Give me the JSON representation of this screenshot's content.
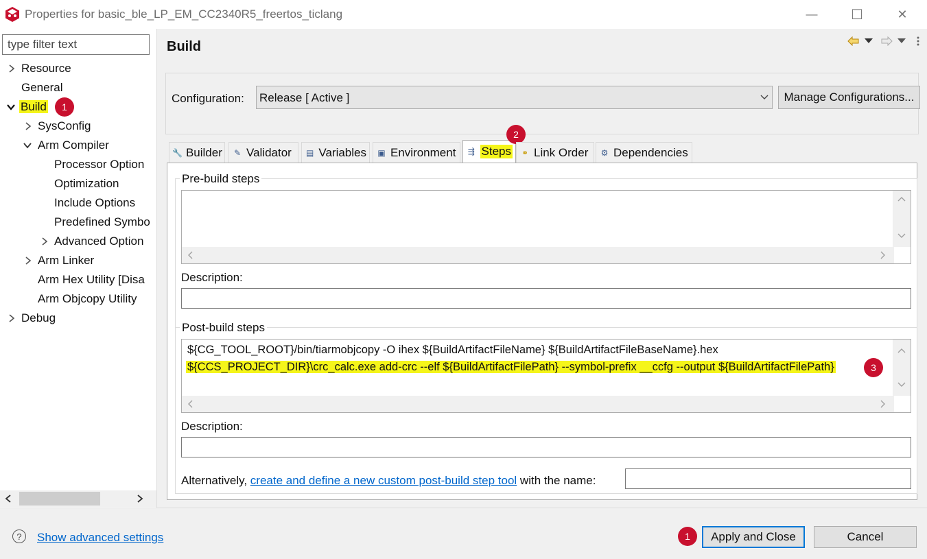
{
  "window": {
    "title": "Properties for basic_ble_LP_EM_CC2340R5_freertos_ticlang",
    "minimize_glyph": "—",
    "maximize_glyph": "☐",
    "close_glyph": "✕"
  },
  "filter": {
    "placeholder": "type filter text"
  },
  "tree": {
    "resource": "Resource",
    "general": "General",
    "build": "Build",
    "sysconfig": "SysConfig",
    "arm_compiler": "Arm Compiler",
    "processor_options": "Processor Option",
    "optimization": "Optimization",
    "include_options": "Include Options",
    "predefined_symbols": "Predefined Symbo",
    "advanced_options": "Advanced Option",
    "arm_linker": "Arm Linker",
    "arm_hex_utility": "Arm Hex Utility  [Disa",
    "arm_objcopy_utility": "Arm Objcopy Utility",
    "debug": "Debug"
  },
  "badges": {
    "b1": "1",
    "b2": "2",
    "b3": "3",
    "b4": "1"
  },
  "page": {
    "title": "Build"
  },
  "config": {
    "label": "Configuration:",
    "value": "Release  [ Active ]",
    "manage_button": "Manage Configurations..."
  },
  "tabs": {
    "builder": "Builder",
    "validator": "Validator",
    "variables": "Variables",
    "environment": "Environment",
    "steps": "Steps",
    "link_order": "Link Order",
    "dependencies": "Dependencies"
  },
  "prebuild": {
    "title": "Pre-build steps",
    "description_label": "Description:"
  },
  "postbuild": {
    "title": "Post-build steps",
    "line1": "${CG_TOOL_ROOT}/bin/tiarmobjcopy -O ihex ${BuildArtifactFileName} ${BuildArtifactFileBaseName}.hex",
    "line2": "${CCS_PROJECT_DIR}\\crc_calc.exe add-crc --elf ${BuildArtifactFilePath} --symbol-prefix __ccfg --output ${BuildArtifactFilePath}",
    "description_label": "Description:",
    "alt_prefix": "Alternatively, ",
    "alt_link": "create and define a new custom post-build step tool",
    "alt_suffix": " with the name:"
  },
  "footer": {
    "help_glyph": "?",
    "advanced_link": "Show advanced settings",
    "apply_close": "Apply and Close",
    "cancel": "Cancel"
  },
  "colors": {
    "highlight": "#f5f51a",
    "badge": "#c8102e",
    "link": "#0066cc"
  }
}
